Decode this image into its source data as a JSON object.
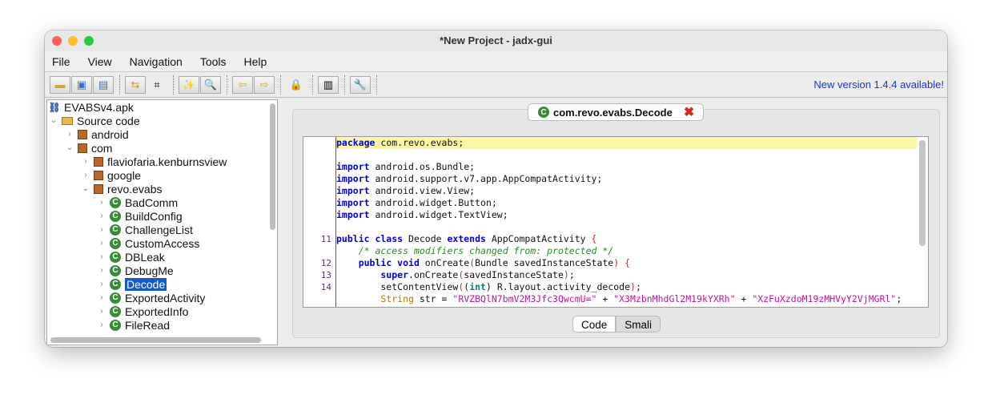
{
  "window": {
    "title": "*New Project - jadx-gui"
  },
  "menu": [
    "File",
    "View",
    "Navigation",
    "Tools",
    "Help"
  ],
  "toolbar": {
    "new_version": "New version 1.4.4 available!",
    "buttons": [
      "open-file-icon",
      "save-all-icon",
      "export-icon",
      "sync-icon",
      "flatten-packages-icon",
      "deobfuscation-icon",
      "search-icon",
      "back-icon",
      "forward-icon",
      "decompile-all-icon",
      "log-icon",
      "preferences-icon"
    ]
  },
  "tree": [
    {
      "label": "EVABSv4.apk",
      "depth": 0,
      "icon": "apk",
      "exp": ""
    },
    {
      "label": "Source code",
      "depth": 0,
      "icon": "folder",
      "exp": "v"
    },
    {
      "label": "android",
      "depth": 1,
      "icon": "pkg",
      "exp": ">"
    },
    {
      "label": "com",
      "depth": 1,
      "icon": "pkg",
      "exp": "v"
    },
    {
      "label": "flaviofaria.kenburnsview",
      "depth": 2,
      "icon": "pkg",
      "exp": ">"
    },
    {
      "label": "google",
      "depth": 2,
      "icon": "pkg",
      "exp": ">"
    },
    {
      "label": "revo.evabs",
      "depth": 2,
      "icon": "pkg",
      "exp": "v"
    },
    {
      "label": "BadComm",
      "depth": 3,
      "icon": "cls",
      "exp": ">"
    },
    {
      "label": "BuildConfig",
      "depth": 3,
      "icon": "cls",
      "exp": ">"
    },
    {
      "label": "ChallengeList",
      "depth": 3,
      "icon": "cls",
      "exp": ">"
    },
    {
      "label": "CustomAccess",
      "depth": 3,
      "icon": "cls",
      "exp": ">"
    },
    {
      "label": "DBLeak",
      "depth": 3,
      "icon": "cls",
      "exp": ">"
    },
    {
      "label": "DebugMe",
      "depth": 3,
      "icon": "cls",
      "exp": ">"
    },
    {
      "label": "Decode",
      "depth": 3,
      "icon": "cls",
      "exp": ">",
      "selected": true
    },
    {
      "label": "ExportedActivity",
      "depth": 3,
      "icon": "cls",
      "exp": ">"
    },
    {
      "label": "ExportedInfo",
      "depth": 3,
      "icon": "cls",
      "exp": ">"
    },
    {
      "label": "FileRead",
      "depth": 3,
      "icon": "cls",
      "exp": ">"
    }
  ],
  "tab": {
    "label": "com.revo.evabs.Decode",
    "close": "✖"
  },
  "code": [
    {
      "n": "",
      "hl": true,
      "t": [
        [
          "kw",
          "package"
        ],
        [
          "pl",
          " com.revo.evabs;"
        ]
      ]
    },
    {
      "n": "",
      "t": []
    },
    {
      "n": "",
      "t": [
        [
          "kw",
          "import"
        ],
        [
          "pl",
          " android.os.Bundle;"
        ]
      ]
    },
    {
      "n": "",
      "t": [
        [
          "kw",
          "import"
        ],
        [
          "pl",
          " android.support.v7.app.AppCompatActivity;"
        ]
      ]
    },
    {
      "n": "",
      "t": [
        [
          "kw",
          "import"
        ],
        [
          "pl",
          " android.view.View;"
        ]
      ]
    },
    {
      "n": "",
      "t": [
        [
          "kw",
          "import"
        ],
        [
          "pl",
          " android.widget.Button;"
        ]
      ]
    },
    {
      "n": "",
      "t": [
        [
          "kw",
          "import"
        ],
        [
          "pl",
          " android.widget.TextView;"
        ]
      ]
    },
    {
      "n": "",
      "t": []
    },
    {
      "n": "11",
      "t": [
        [
          "kw",
          "public class"
        ],
        [
          "pl",
          " Decode "
        ],
        [
          "kw",
          "extends"
        ],
        [
          "pl",
          " AppCompatActivity "
        ],
        [
          "br",
          "{"
        ]
      ]
    },
    {
      "n": "",
      "t": [
        [
          "pl",
          "    "
        ],
        [
          "cm",
          "/* access modifiers changed from: protected */"
        ]
      ]
    },
    {
      "n": "12",
      "t": [
        [
          "pl",
          "    "
        ],
        [
          "kw",
          "public void"
        ],
        [
          "pl",
          " onCreate"
        ],
        [
          "br",
          "("
        ],
        [
          "pl",
          "Bundle savedInstanceState"
        ],
        [
          "br",
          ")"
        ],
        [
          "pl",
          " "
        ],
        [
          "br",
          "{"
        ]
      ]
    },
    {
      "n": "13",
      "t": [
        [
          "pl",
          "        "
        ],
        [
          "kw",
          "super"
        ],
        [
          "pl",
          ".onCreate"
        ],
        [
          "br",
          "("
        ],
        [
          "pl",
          "savedInstanceState"
        ],
        [
          "br",
          ")"
        ],
        [
          "pl",
          ";"
        ]
      ]
    },
    {
      "n": "14",
      "t": [
        [
          "pl",
          "        setContentView"
        ],
        [
          "br",
          "("
        ],
        [
          "pl",
          "("
        ],
        [
          "kt",
          "int"
        ],
        [
          "pl",
          ") R.layout.activity_decode"
        ],
        [
          "br",
          ")"
        ],
        [
          "pl",
          ";"
        ]
      ]
    },
    {
      "n": "",
      "t": [
        [
          "pl",
          "        "
        ],
        [
          "ty",
          "String"
        ],
        [
          "pl",
          " str = "
        ],
        [
          "st",
          "\"RVZBQlN7bmV2M3Jfc3QwcmU=\""
        ],
        [
          "pl",
          " + "
        ],
        [
          "st",
          "\"X3MzbnMhdGl2M19kYXRh\""
        ],
        [
          "pl",
          " + "
        ],
        [
          "st",
          "\"XzFuXzdoM19zMHVyY2VjMGRl\""
        ],
        [
          "pl",
          ";"
        ]
      ]
    }
  ],
  "view_buttons": {
    "code": "Code",
    "smali": "Smali"
  }
}
